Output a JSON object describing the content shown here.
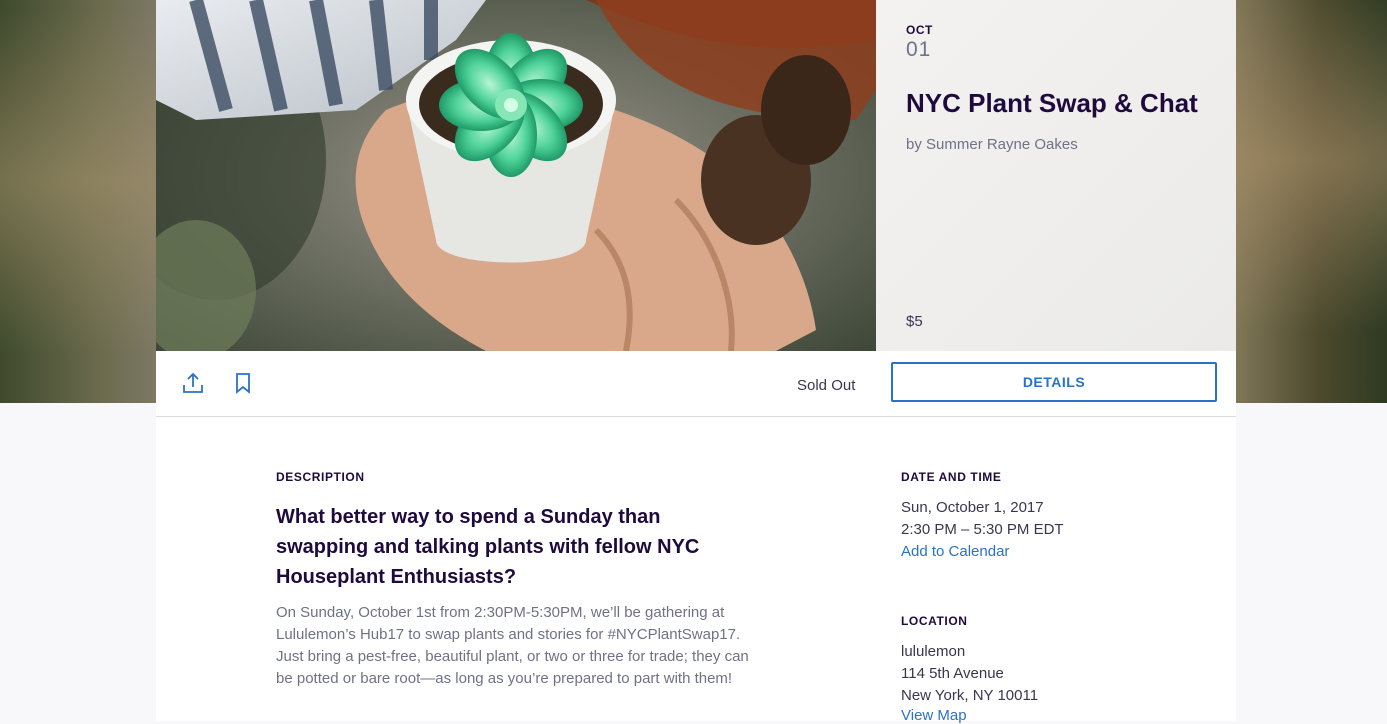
{
  "event": {
    "month": "OCT",
    "day": "01",
    "title": "NYC Plant Swap & Chat",
    "organizer": "by Summer Rayne Oakes",
    "price": "$5"
  },
  "actions": {
    "status": "Sold Out",
    "details_label": "DETAILS",
    "share_icon": "share-icon",
    "bookmark_icon": "bookmark-icon"
  },
  "description": {
    "label": "DESCRIPTION",
    "heading": "What better way to spend a Sunday than swapping and talking plants with fellow NYC Houseplant Enthusiasts?",
    "body": "On Sunday, October 1st from 2:30PM-5:30PM, we’ll be gathering at Lululemon’s Hub17 to swap plants and stories for #NYCPlantSwap17. Just bring a pest-free, beautiful plant, or two or three for trade; they can be potted or bare root—as long as you’re prepared to part with them!"
  },
  "date_time": {
    "label": "DATE AND TIME",
    "date": "Sun, October 1, 2017",
    "time": "2:30 PM – 5:30 PM EDT",
    "calendar_link": "Add to Calendar"
  },
  "location": {
    "label": "LOCATION",
    "name": "lululemon",
    "street": "114 5th Avenue",
    "city": "New York, NY 10011",
    "map_link": "View Map"
  },
  "colors": {
    "accent": "#2a72c6",
    "text_dark": "#1e0a3c",
    "text_muted": "#6f7287"
  }
}
